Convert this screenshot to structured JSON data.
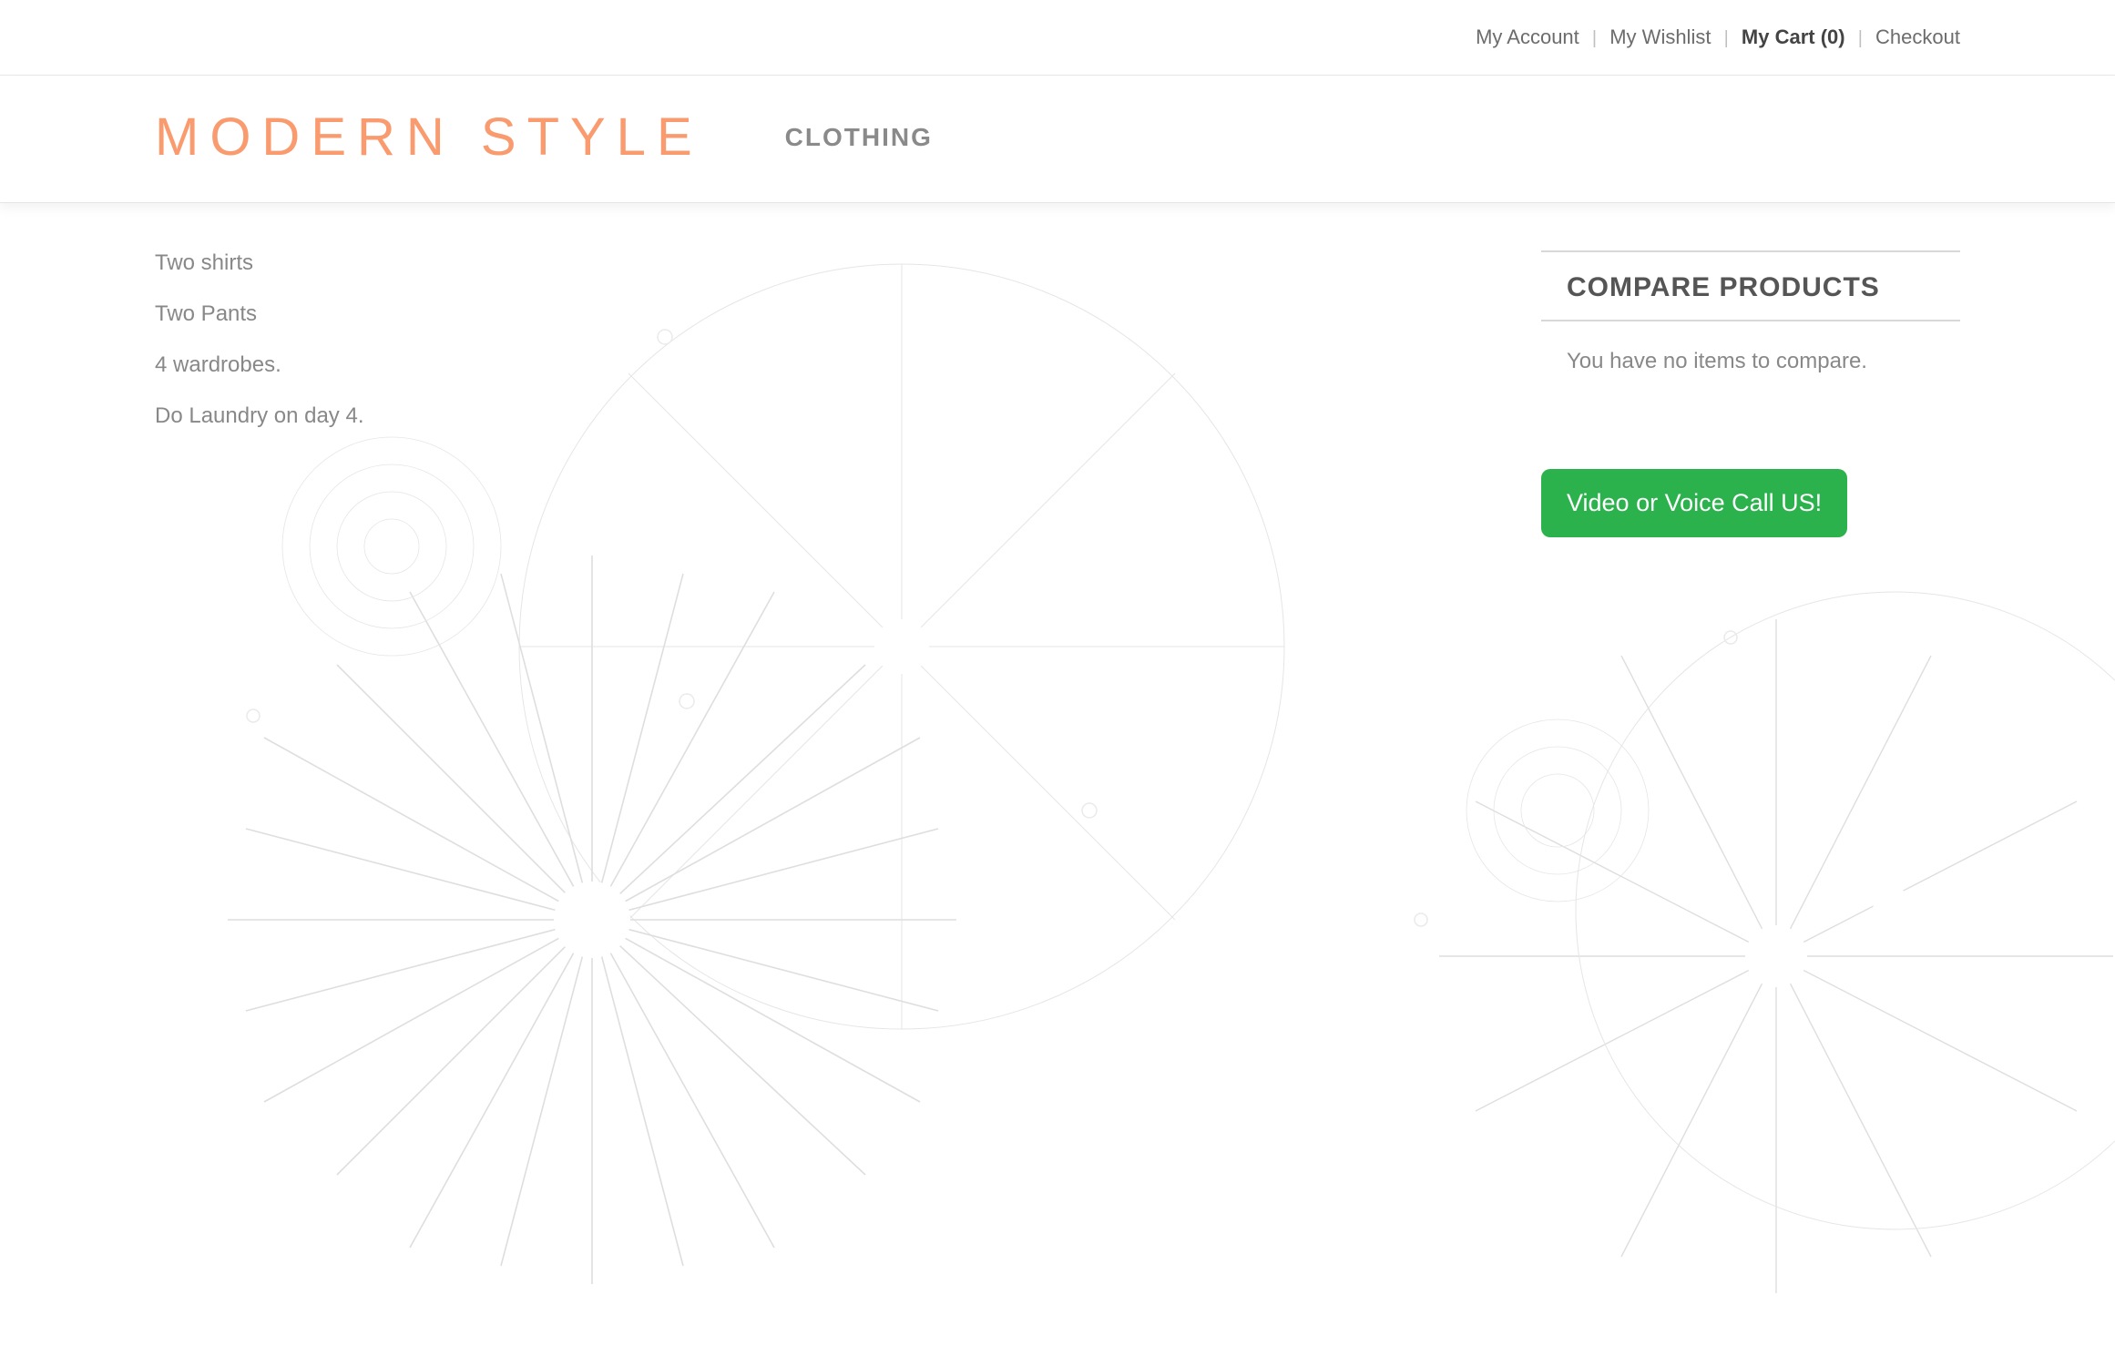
{
  "topbar": {
    "my_account": "My Account",
    "my_wishlist": "My Wishlist",
    "my_cart": "My Cart (0)",
    "checkout": "Checkout"
  },
  "header": {
    "logo_text": "MODERN STYLE",
    "nav_item_1": "CLOTHING"
  },
  "content": {
    "line_1": "Two shirts",
    "line_2": "Two Pants",
    "line_3": "4 wardrobes.",
    "line_4": "Do Laundry on day 4."
  },
  "sidebar": {
    "compare_title": "COMPARE PRODUCTS",
    "compare_empty": "You have no items to compare.",
    "call_button": "Video or Voice Call US!"
  }
}
